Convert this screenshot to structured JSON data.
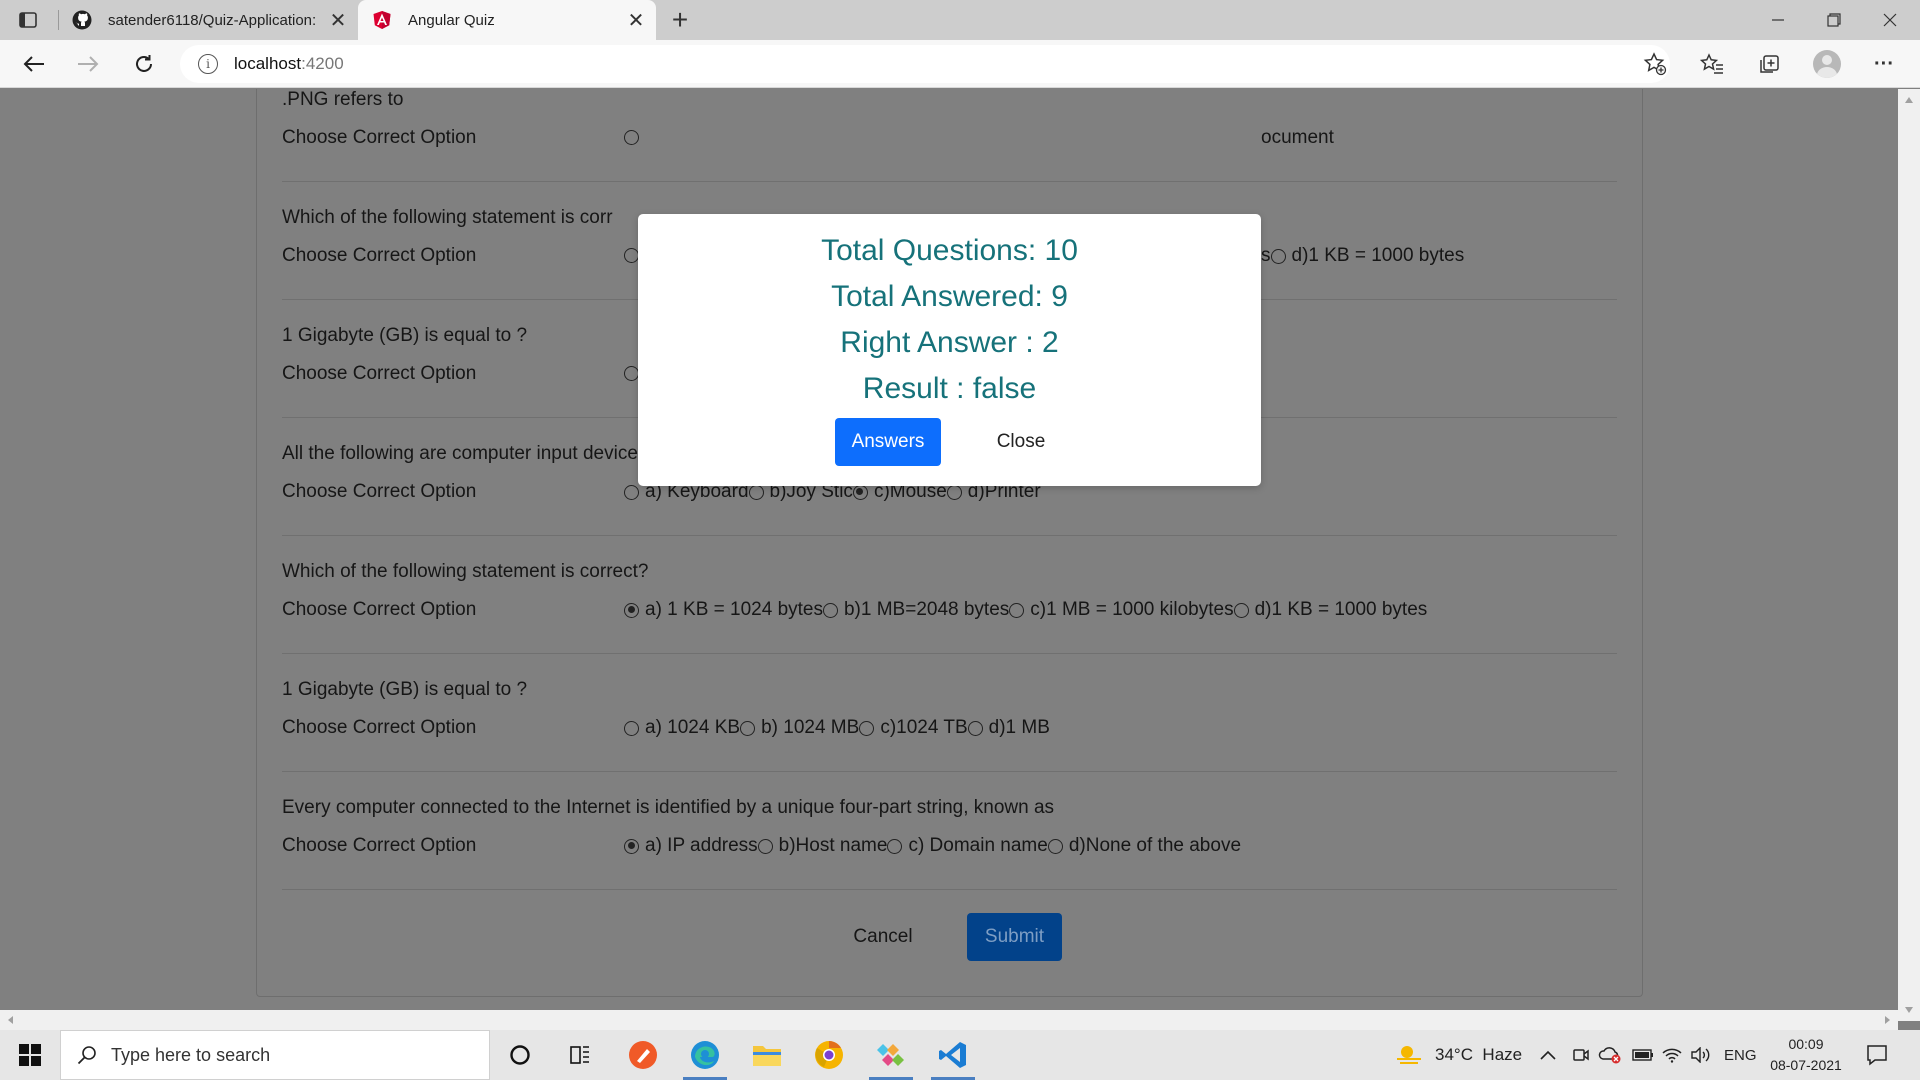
{
  "browser": {
    "tabs": [
      {
        "label": "satender6118/Quiz-Application:",
        "favicon": "github-icon"
      },
      {
        "label": "Angular Quiz",
        "favicon": "angular-icon"
      }
    ],
    "url_host": "localhost",
    "url_port": ":4200"
  },
  "quiz": {
    "choose_label": "Choose Correct Option",
    "partial_top_question": ".PNG refers to",
    "partial_fragments": {
      "q1_right": "ocument",
      "q2_right_s": "s",
      "q2_right_option": "d)1 KB = 1000 bytes"
    },
    "partial_q2": "Which of the following statement is corr",
    "partial_q3": "1 Gigabyte (GB) is equal to ?",
    "questions": [
      {
        "text": "All the following are computer input devices except for",
        "options": [
          "a) Keyboard",
          "b)Joy Stic",
          "c)Mouse",
          "d)Printer"
        ],
        "selected": 2
      },
      {
        "text": "Which of the following statement is correct?",
        "options": [
          "a) 1 KB = 1024 bytes",
          "b)1 MB=2048 bytes",
          "c)1 MB = 1000 kilobytes",
          "d)1 KB = 1000 bytes"
        ],
        "selected": 0
      },
      {
        "text": "1 Gigabyte (GB) is equal to ?",
        "options": [
          "a) 1024 KB",
          "b) 1024 MB",
          "c)1024 TB",
          "d)1 MB"
        ],
        "selected": -1
      },
      {
        "text": "Every computer connected to the Internet is identified by a unique four-part string, known as",
        "options": [
          "a) IP address",
          "b)Host name",
          "c) Domain name",
          "d)None of the above"
        ],
        "selected": 0
      }
    ],
    "cancel_label": "Cancel",
    "submit_label": "Submit"
  },
  "modal": {
    "total_questions": "Total Questions: 10",
    "total_answered": "Total Answered: 9",
    "right_answer": "Right Answer : 2",
    "result": "Result : false",
    "answers_label": "Answers",
    "close_label": "Close"
  },
  "taskbar": {
    "search_placeholder": "Type here to search",
    "weather": "34°C  Haze",
    "language": "ENG",
    "time": "00:09",
    "date": "08-07-2021"
  },
  "colors": {
    "modal_text": "#16727a",
    "primary_button": "#0d6efd",
    "submit_dimmed": "#02428a"
  }
}
